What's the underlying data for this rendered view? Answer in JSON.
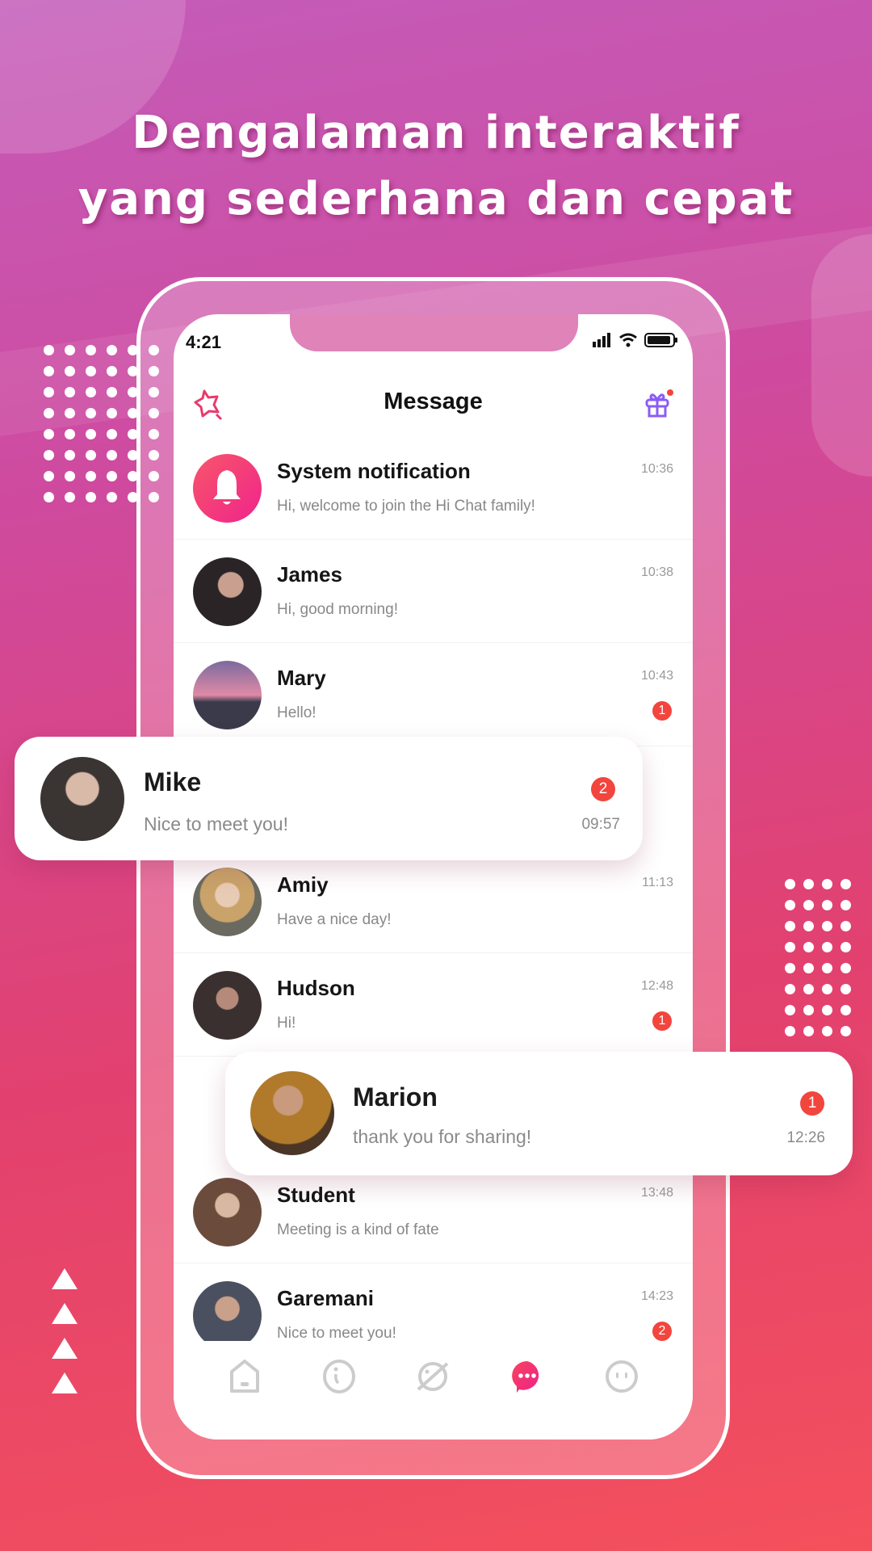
{
  "headline": {
    "line1": "Dengalaman interaktif",
    "line2": "yang sederhana dan cepat"
  },
  "colors": {
    "accent": "#f2417a",
    "badge": "#f2453d",
    "gift": "#8a5cf6"
  },
  "status_bar": {
    "time": "4:21",
    "icons": [
      "signal-icon",
      "wifi-icon",
      "battery-icon"
    ]
  },
  "header": {
    "title": "Message",
    "left_icon": "star-search-icon",
    "right_icon": "gift-icon"
  },
  "messages": [
    {
      "name": "System notification",
      "message": "Hi, welcome to join the Hi Chat family!",
      "time": "10:36",
      "badge": ""
    },
    {
      "name": "James",
      "message": "Hi, good morning!",
      "time": "10:38",
      "badge": ""
    },
    {
      "name": "Mary",
      "message": "Hello!",
      "time": "10:43",
      "badge": "1"
    },
    {
      "name": "Amiy",
      "message": "Have a nice day!",
      "time": "11:13",
      "badge": ""
    },
    {
      "name": "Hudson",
      "message": "Hi!",
      "time": "12:48",
      "badge": "1"
    },
    {
      "name": "Student",
      "message": "Meeting is a kind of fate",
      "time": "13:48",
      "badge": ""
    },
    {
      "name": "Garemani",
      "message": "Nice to meet you!",
      "time": "14:23",
      "badge": "2"
    }
  ],
  "cards": [
    {
      "name": "Mike",
      "message": "Nice to meet you!",
      "time": "09:57",
      "badge": "2"
    },
    {
      "name": "Marion",
      "message": "thank you for sharing!",
      "time": "12:26",
      "badge": "1"
    }
  ],
  "nav": {
    "items": [
      "home-icon",
      "info-icon",
      "planet-icon",
      "chat-icon",
      "profile-icon"
    ],
    "active": "chat-icon"
  }
}
